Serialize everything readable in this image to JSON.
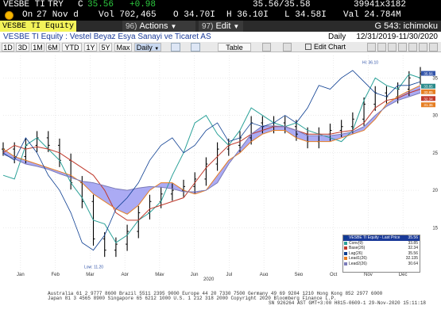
{
  "quote": {
    "ticker": "VESBE TI",
    "currency": "TRY",
    "c_label": "C",
    "last": "35.56",
    "change": "+0.98",
    "bid_ask": "35.56/35.58",
    "size": "39941x3182",
    "on_label": "On",
    "date": "27 Nov d",
    "vol_label": "Vol",
    "volume": "702,465",
    "open_label": "O",
    "open": "34.70I",
    "high_label": "H",
    "high": "36.10I",
    "low_label": "L",
    "low": "34.58I",
    "val_label": "Val",
    "value": "24.784M"
  },
  "toolbar": {
    "security_input": "VESBE TI Equity",
    "menu1_num": "96)",
    "menu1_label": "Actions",
    "menu2_num": "97)",
    "menu2_label": "Edit",
    "title": "G 543: ichimoku"
  },
  "title_strip": {
    "name": "VESBE TI Equity : Vestel Beyaz Esya Sanayi ve Ticaret AS",
    "period": "Daily",
    "range": "12/31/2019-11/30/2020"
  },
  "range_buttons": [
    "1D",
    "3D",
    "1M",
    "6M",
    "YTD",
    "1Y",
    "5Y",
    "Max"
  ],
  "range_selected": "Daily",
  "range_table_label": "Table",
  "range_edit_label": "Edit Chart",
  "chart_data": {
    "type": "line",
    "title": "",
    "x_months": [
      "Jan",
      "Feb",
      "Mar",
      "Apr",
      "May",
      "Jun",
      "Jul",
      "Aug",
      "Sep",
      "Oct",
      "Nov",
      "Dec"
    ],
    "year_label": "2020",
    "y_ticks": [
      "35",
      "30",
      "25",
      "20",
      "15"
    ],
    "ylim": [
      9,
      38
    ],
    "annotations": {
      "high": "Hi: 36.10",
      "low": "Low: 11.20"
    },
    "right_labels": [
      "35.56",
      "33.85",
      "32.34",
      "32.85",
      "31.36"
    ],
    "right_label_colors": [
      "#3355aa",
      "#2a8a8a",
      "#c0392b",
      "#e67e22",
      "#e67e22"
    ],
    "series": [
      {
        "name": "Conv(9)",
        "color": "#2aa198",
        "values": [
          22,
          21.5,
          26,
          27,
          25.5,
          24,
          21,
          19,
          16,
          15.5,
          13,
          14,
          16,
          17,
          18.5,
          22,
          25,
          29,
          30,
          27.5,
          26,
          28,
          31,
          30,
          29,
          28.5,
          29,
          28,
          27.5,
          27,
          26.5,
          28,
          32,
          35,
          34,
          33.5,
          35.5,
          35
        ]
      },
      {
        "name": "Base(26)",
        "color": "#c0392b",
        "values": [
          25,
          26,
          25.5,
          25.8,
          25.5,
          25,
          24,
          23,
          22,
          20,
          17,
          16,
          16,
          17.5,
          18,
          18.5,
          19,
          21,
          23,
          24.5,
          26,
          26.5,
          27.5,
          28,
          28.5,
          28.5,
          28,
          27.5,
          27.5,
          27.5,
          27.8,
          28,
          29,
          31,
          32,
          32.3,
          33,
          33.5
        ]
      },
      {
        "name": "Lead1(26)",
        "color": "#e67e22",
        "values": [
          25.5,
          24.5,
          24,
          23.5,
          23,
          22.5,
          22,
          21,
          19.5,
          18.5,
          17.5,
          16.8,
          18,
          20,
          21,
          21,
          20,
          19.5,
          20,
          22,
          24,
          25,
          26.5,
          27.5,
          28,
          28,
          27,
          26.5,
          26.5,
          26.5,
          27,
          27.5,
          28,
          29.5,
          31.5,
          32.5,
          33.3,
          34
        ]
      },
      {
        "name": "Lead2(26)",
        "color": "#7b7bb8",
        "values": [
          24.8,
          24.2,
          23.5,
          23.2,
          22.8,
          22.2,
          21.7,
          21.2,
          21,
          20.6,
          20.2,
          20,
          20.3,
          20.5,
          20.4,
          20.2,
          19.8,
          19.8,
          20,
          21,
          23.5,
          25.5,
          27.5,
          28.6,
          28.6,
          28.5,
          28,
          27.3,
          27.3,
          27.3,
          27.5,
          27.8,
          28.5,
          30,
          31.2,
          32,
          32.5,
          33
        ]
      },
      {
        "name": "Lag(26)",
        "color": "#0b3d91",
        "values": [
          25,
          24,
          27,
          25,
          22,
          20,
          17,
          13,
          12,
          14,
          17.5,
          19,
          21,
          24,
          26,
          27,
          25,
          26,
          28,
          29,
          26.5,
          27,
          29,
          28.5,
          29,
          30,
          29,
          31,
          34,
          33.5,
          35,
          36,
          34.5,
          33,
          32.5,
          34,
          34,
          34.5
        ]
      },
      {
        "name": "VESBE TI Equity - Last Price",
        "color": "#000000",
        "values": [
          25.5,
          24.5,
          26,
          27,
          26,
          24,
          21,
          18.5,
          13.5,
          12,
          12.8,
          14.5,
          17,
          18.5,
          19.5,
          20,
          20.5,
          21.5,
          23.5,
          25.5,
          26,
          27,
          29,
          28.5,
          29,
          28.5,
          27.5,
          26.5,
          27.5,
          28,
          28.5,
          29.5,
          31.5,
          33,
          32.5,
          33.5,
          35,
          35.56
        ]
      }
    ]
  },
  "legend": {
    "items": [
      {
        "label": "VESBE TI Equity - Last Price",
        "value": "35.56",
        "color": "#0b3d91"
      },
      {
        "label": "Conv(9)",
        "value": "33.85",
        "color": "#2aa198"
      },
      {
        "label": "Base(26)",
        "value": "32.34",
        "color": "#c0392b"
      },
      {
        "label": "Lag(26)",
        "value": "35.56",
        "color": "#0b3d91"
      },
      {
        "label": "Lead1(26)",
        "value": "32.135",
        "color": "#e67e22"
      },
      {
        "label": "Lead2(26)",
        "value": "30.64",
        "color": "#7b7bb8"
      }
    ]
  },
  "footer": {
    "line1": "Australia 61 2 9777 8600 Brazil 5511 2395 9000 Europe 44 20 7330 7500 Germany 49 69 9204 1210 Hong Kong 852 2977 6000",
    "line2": "Japan 81 3 4565 8900         Singapore 65 6212 1000         U.S. 1 212 318 2000         Copyright 2020 Bloomberg Finance L.P.",
    "line3": "SN 926264 AST  GMT+3:00 H815-0609-1 29-Nov-2020 15:11:18"
  }
}
